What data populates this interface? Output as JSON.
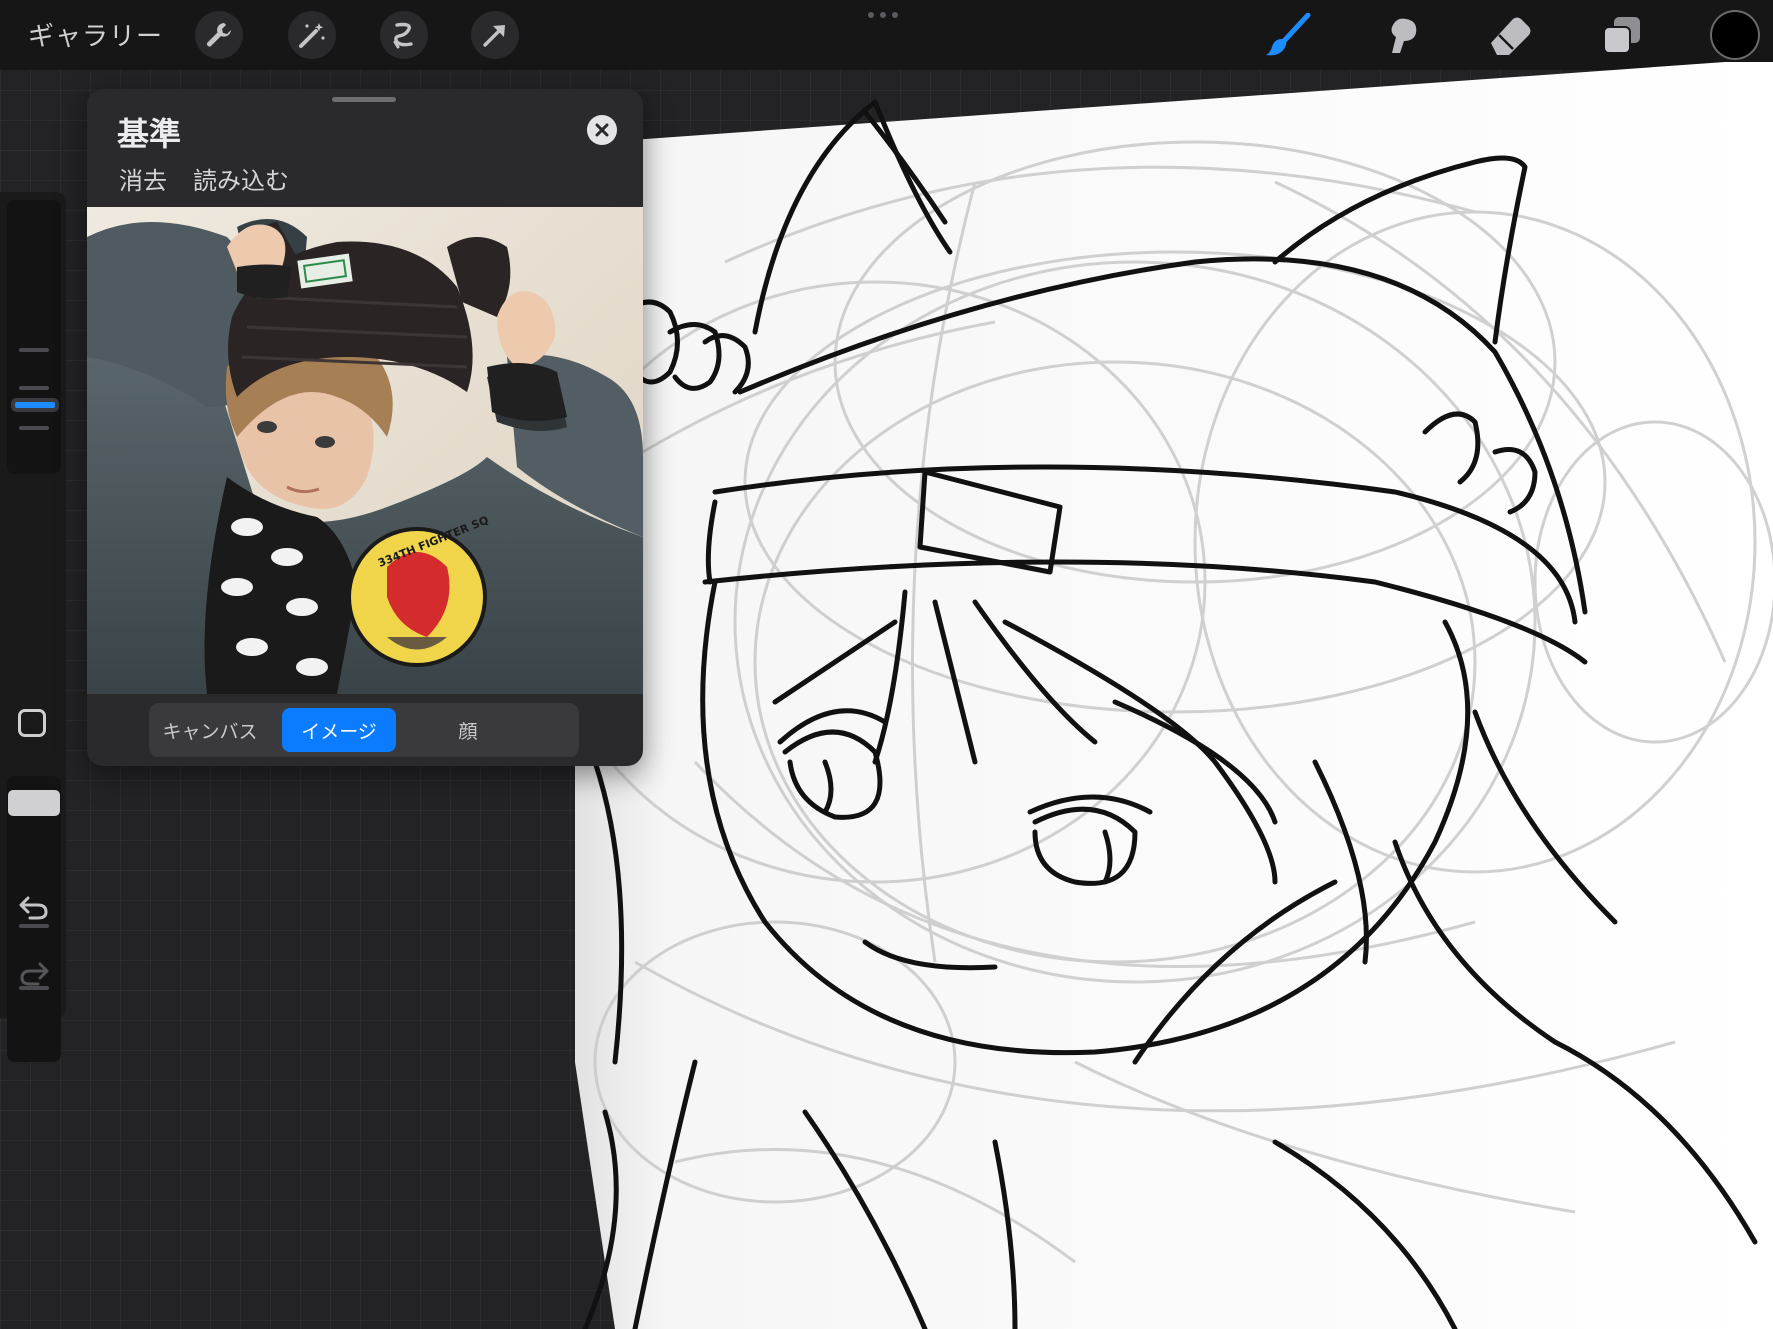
{
  "topbar": {
    "gallery_label": "ギャラリー",
    "left_tools": [
      "wrench-icon",
      "magic-wand-icon",
      "selection-icon",
      "transform-arrow-icon"
    ],
    "right_tools": [
      "brush-icon",
      "smudge-icon",
      "eraser-icon",
      "layers-icon"
    ],
    "active_tool": "brush-icon",
    "current_color": "#000000",
    "accent": "#0b7bff"
  },
  "sidebar": {
    "controls": [
      "brush-size-slider",
      "modify-button",
      "opacity-slider",
      "undo-icon",
      "redo-icon"
    ]
  },
  "reference": {
    "title": "基準",
    "actions": {
      "clear": "消去",
      "import": "読み込む"
    },
    "tabs": [
      {
        "label": "キャンバス",
        "active": false
      },
      {
        "label": "イメージ",
        "active": true
      },
      {
        "label": "顔",
        "active": false
      }
    ],
    "photo": {
      "tag_text": "",
      "patch_text": "334TH FIGHTER SQ"
    }
  }
}
